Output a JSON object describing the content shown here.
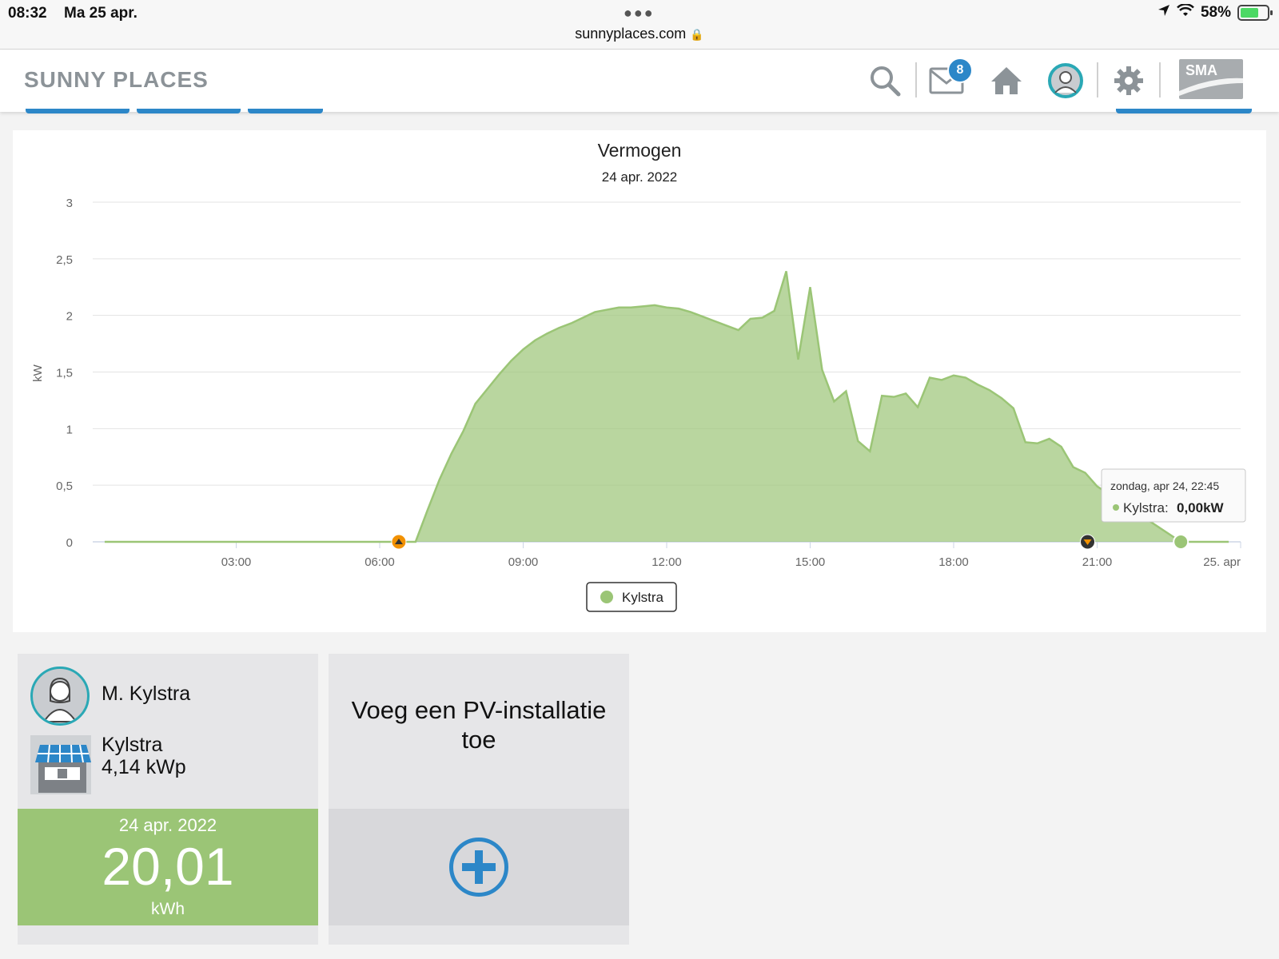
{
  "status_bar": {
    "time": "08:32",
    "date": "Ma 25 apr.",
    "url": "sunnyplaces.com",
    "battery": "58%"
  },
  "header": {
    "logo": "SUNNY PLACES",
    "messages_count": "8",
    "sma_label": "SMA",
    "icons": [
      "search-icon",
      "mail-icon",
      "home-icon",
      "profile-icon",
      "gear-icon",
      "sma-logo"
    ]
  },
  "chart_data": {
    "type": "area",
    "title": "Vermogen",
    "subtitle": "24 apr. 2022",
    "ylabel": "kW",
    "ylim": [
      0,
      3
    ],
    "yticks": [
      "0",
      "0,5",
      "1",
      "1,5",
      "2",
      "2,5",
      "3"
    ],
    "xlim": [
      0,
      24
    ],
    "xticks": [
      {
        "x": 3,
        "label": "03:00"
      },
      {
        "x": 6,
        "label": "06:00"
      },
      {
        "x": 9,
        "label": "09:00"
      },
      {
        "x": 12,
        "label": "12:00"
      },
      {
        "x": 15,
        "label": "15:00"
      },
      {
        "x": 18,
        "label": "18:00"
      },
      {
        "x": 21,
        "label": "21:00"
      },
      {
        "x": 24,
        "label": "25. apr"
      }
    ],
    "series": [
      {
        "name": "Kylstra",
        "color": "#9bc576",
        "x": [
          0.25,
          6.75,
          7.0,
          7.25,
          7.5,
          7.75,
          8.0,
          8.25,
          8.5,
          8.75,
          9.0,
          9.25,
          9.5,
          9.75,
          10.0,
          10.25,
          10.5,
          10.75,
          11.0,
          11.25,
          11.5,
          11.75,
          12.0,
          12.25,
          12.5,
          12.75,
          13.0,
          13.25,
          13.5,
          13.75,
          14.0,
          14.25,
          14.5,
          14.75,
          15.0,
          15.25,
          15.5,
          15.75,
          16.0,
          16.25,
          16.5,
          16.75,
          17.0,
          17.25,
          17.5,
          17.75,
          18.0,
          18.25,
          18.5,
          18.75,
          19.0,
          19.25,
          19.5,
          19.75,
          20.0,
          20.25,
          20.5,
          20.75,
          21.0,
          22.75,
          23.75
        ],
        "y": [
          0.0,
          0.0,
          0.28,
          0.55,
          0.78,
          0.98,
          1.22,
          1.35,
          1.48,
          1.6,
          1.7,
          1.78,
          1.84,
          1.89,
          1.93,
          1.98,
          2.03,
          2.05,
          2.07,
          2.07,
          2.08,
          2.09,
          2.07,
          2.06,
          2.03,
          1.99,
          1.95,
          1.91,
          1.87,
          1.97,
          1.98,
          2.04,
          2.39,
          1.61,
          2.25,
          1.52,
          1.24,
          1.33,
          0.89,
          0.8,
          1.29,
          1.28,
          1.31,
          1.19,
          1.45,
          1.43,
          1.47,
          1.45,
          1.39,
          1.34,
          1.27,
          1.18,
          0.88,
          0.87,
          0.91,
          0.84,
          0.66,
          0.61,
          0.49,
          0.0,
          0.0
        ]
      }
    ],
    "markers": [
      {
        "name": "sunrise-marker",
        "x": 6.4,
        "color": "#f29100"
      },
      {
        "name": "sunset-marker",
        "x": 20.8,
        "color": "#333333"
      }
    ],
    "legend": "bottom-center",
    "grid": true,
    "tooltip": {
      "title": "zondag, apr 24, 22:45",
      "series": "Kylstra",
      "value": "0,00kW",
      "x": 22.75
    }
  },
  "tiles": {
    "user": {
      "owner": "M. Kylstra",
      "plant_name": "Kylstra",
      "plant_power": "4,14 kWp",
      "yield_date": "24 apr. 2022",
      "yield_value": "20,01",
      "yield_unit": "kWh"
    },
    "add": {
      "label": "Voeg een PV-installatie toe"
    }
  }
}
